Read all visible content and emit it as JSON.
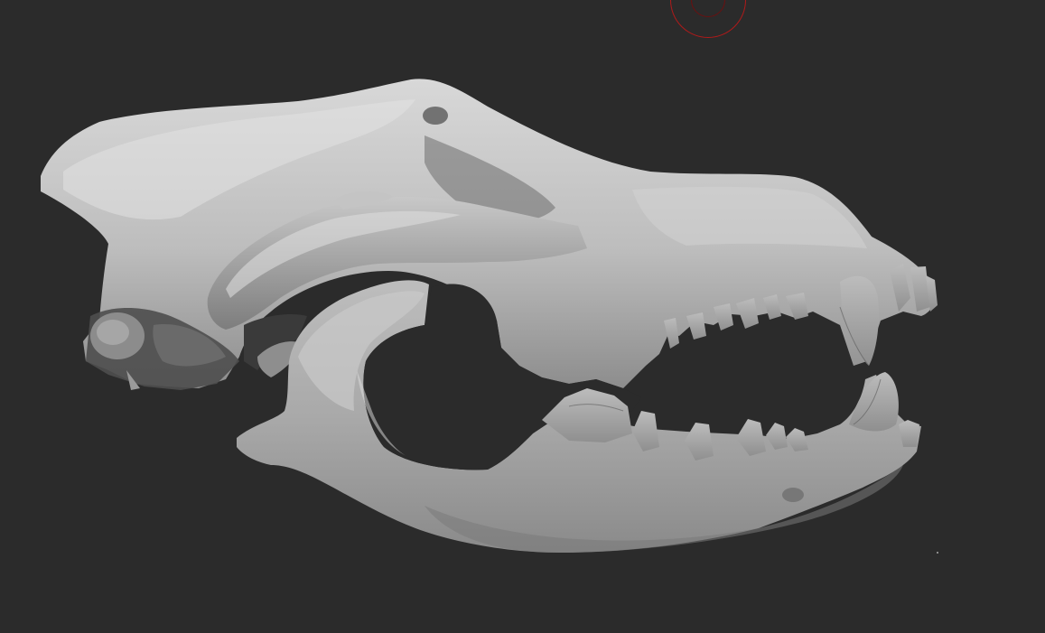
{
  "viewport": {
    "background": "#2b2b2b",
    "mesh": "skull",
    "material_colors": {
      "light": "#dedede",
      "mid": "#9a9a9a",
      "dark": "#4a4a4a",
      "shadow": "#1e1e1e"
    }
  },
  "brush_cursor": {
    "icon": "brush-radius-circle",
    "color": "#b01a1a"
  }
}
